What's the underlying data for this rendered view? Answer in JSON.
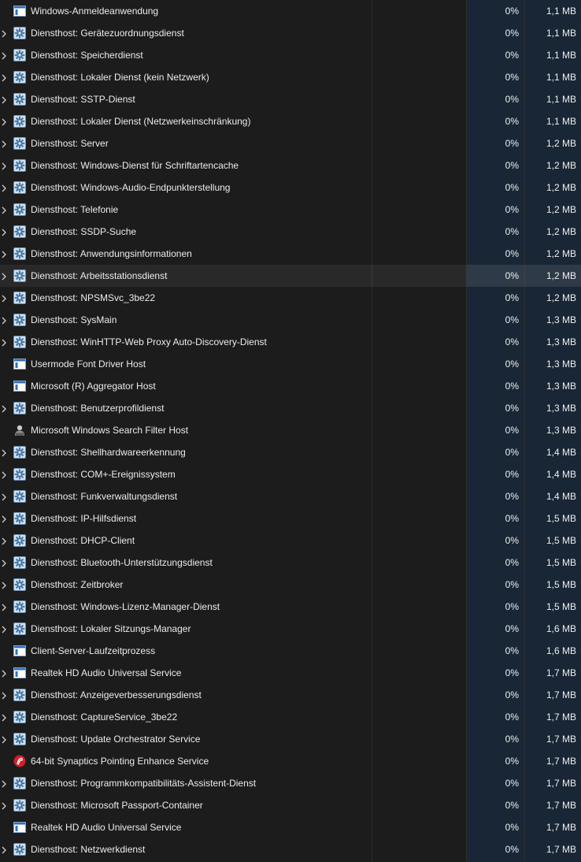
{
  "processes": [
    {
      "name": "Windows-Anmeldeanwendung",
      "icon": "window-icon",
      "expandable": false,
      "cpu": "0%",
      "memory": "1,1 MB"
    },
    {
      "name": "Diensthost: Gerätezuordnungsdienst",
      "icon": "gear-icon",
      "expandable": true,
      "cpu": "0%",
      "memory": "1,1 MB"
    },
    {
      "name": "Diensthost: Speicherdienst",
      "icon": "gear-icon",
      "expandable": true,
      "cpu": "0%",
      "memory": "1,1 MB"
    },
    {
      "name": "Diensthost: Lokaler Dienst (kein Netzwerk)",
      "icon": "gear-icon",
      "expandable": true,
      "cpu": "0%",
      "memory": "1,1 MB"
    },
    {
      "name": "Diensthost: SSTP-Dienst",
      "icon": "gear-icon",
      "expandable": true,
      "cpu": "0%",
      "memory": "1,1 MB"
    },
    {
      "name": "Diensthost: Lokaler Dienst (Netzwerkeinschränkung)",
      "icon": "gear-icon",
      "expandable": true,
      "cpu": "0%",
      "memory": "1,1 MB"
    },
    {
      "name": "Diensthost: Server",
      "icon": "gear-icon",
      "expandable": true,
      "cpu": "0%",
      "memory": "1,2 MB"
    },
    {
      "name": "Diensthost: Windows-Dienst für Schriftartencache",
      "icon": "gear-icon",
      "expandable": true,
      "cpu": "0%",
      "memory": "1,2 MB"
    },
    {
      "name": "Diensthost: Windows-Audio-Endpunkterstellung",
      "icon": "gear-icon",
      "expandable": true,
      "cpu": "0%",
      "memory": "1,2 MB"
    },
    {
      "name": "Diensthost: Telefonie",
      "icon": "gear-icon",
      "expandable": true,
      "cpu": "0%",
      "memory": "1,2 MB"
    },
    {
      "name": "Diensthost: SSDP-Suche",
      "icon": "gear-icon",
      "expandable": true,
      "cpu": "0%",
      "memory": "1,2 MB"
    },
    {
      "name": "Diensthost: Anwendungsinformationen",
      "icon": "gear-icon",
      "expandable": true,
      "cpu": "0%",
      "memory": "1,2 MB"
    },
    {
      "name": "Diensthost: Arbeitsstationsdienst",
      "icon": "gear-icon",
      "expandable": true,
      "cpu": "0%",
      "memory": "1,2 MB",
      "selected": true
    },
    {
      "name": "Diensthost: NPSMSvc_3be22",
      "icon": "gear-icon",
      "expandable": true,
      "cpu": "0%",
      "memory": "1,2 MB"
    },
    {
      "name": "Diensthost: SysMain",
      "icon": "gear-icon",
      "expandable": true,
      "cpu": "0%",
      "memory": "1,3 MB"
    },
    {
      "name": "Diensthost: WinHTTP-Web Proxy Auto-Discovery-Dienst",
      "icon": "gear-icon",
      "expandable": true,
      "cpu": "0%",
      "memory": "1,3 MB"
    },
    {
      "name": "Usermode Font Driver Host",
      "icon": "window-icon",
      "expandable": false,
      "cpu": "0%",
      "memory": "1,3 MB"
    },
    {
      "name": "Microsoft (R) Aggregator Host",
      "icon": "window-icon",
      "expandable": false,
      "cpu": "0%",
      "memory": "1,3 MB"
    },
    {
      "name": "Diensthost: Benutzerprofildienst",
      "icon": "gear-icon",
      "expandable": true,
      "cpu": "0%",
      "memory": "1,3 MB"
    },
    {
      "name": "Microsoft Windows Search Filter Host",
      "icon": "search-filter-icon",
      "expandable": false,
      "cpu": "0%",
      "memory": "1,3 MB"
    },
    {
      "name": "Diensthost: Shellhardwareerkennung",
      "icon": "gear-icon",
      "expandable": true,
      "cpu": "0%",
      "memory": "1,4 MB"
    },
    {
      "name": "Diensthost: COM+-Ereignissystem",
      "icon": "gear-icon",
      "expandable": true,
      "cpu": "0%",
      "memory": "1,4 MB"
    },
    {
      "name": "Diensthost: Funkverwaltungsdienst",
      "icon": "gear-icon",
      "expandable": true,
      "cpu": "0%",
      "memory": "1,4 MB"
    },
    {
      "name": "Diensthost: IP-Hilfsdienst",
      "icon": "gear-icon",
      "expandable": true,
      "cpu": "0%",
      "memory": "1,5 MB"
    },
    {
      "name": "Diensthost: DHCP-Client",
      "icon": "gear-icon",
      "expandable": true,
      "cpu": "0%",
      "memory": "1,5 MB"
    },
    {
      "name": "Diensthost: Bluetooth-Unterstützungsdienst",
      "icon": "gear-icon",
      "expandable": true,
      "cpu": "0%",
      "memory": "1,5 MB"
    },
    {
      "name": "Diensthost: Zeitbroker",
      "icon": "gear-icon",
      "expandable": true,
      "cpu": "0%",
      "memory": "1,5 MB"
    },
    {
      "name": "Diensthost: Windows-Lizenz-Manager-Dienst",
      "icon": "gear-icon",
      "expandable": true,
      "cpu": "0%",
      "memory": "1,5 MB"
    },
    {
      "name": "Diensthost: Lokaler Sitzungs-Manager",
      "icon": "gear-icon",
      "expandable": true,
      "cpu": "0%",
      "memory": "1,6 MB"
    },
    {
      "name": "Client-Server-Laufzeitprozess",
      "icon": "window-icon",
      "expandable": false,
      "cpu": "0%",
      "memory": "1,6 MB"
    },
    {
      "name": "Realtek HD Audio Universal Service",
      "icon": "window-icon",
      "expandable": true,
      "cpu": "0%",
      "memory": "1,7 MB"
    },
    {
      "name": "Diensthost: Anzeigeverbesserungsdienst",
      "icon": "gear-icon",
      "expandable": true,
      "cpu": "0%",
      "memory": "1,7 MB"
    },
    {
      "name": "Diensthost: CaptureService_3be22",
      "icon": "gear-icon",
      "expandable": true,
      "cpu": "0%",
      "memory": "1,7 MB"
    },
    {
      "name": "Diensthost: Update Orchestrator Service",
      "icon": "gear-icon",
      "expandable": true,
      "cpu": "0%",
      "memory": "1,7 MB"
    },
    {
      "name": "64-bit Synaptics Pointing Enhance Service",
      "icon": "synaptics-icon",
      "expandable": false,
      "cpu": "0%",
      "memory": "1,7 MB"
    },
    {
      "name": "Diensthost: Programmkompatibilitäts-Assistent-Dienst",
      "icon": "gear-icon",
      "expandable": true,
      "cpu": "0%",
      "memory": "1,7 MB"
    },
    {
      "name": "Diensthost: Microsoft Passport-Container",
      "icon": "gear-icon",
      "expandable": true,
      "cpu": "0%",
      "memory": "1,7 MB"
    },
    {
      "name": "Realtek HD Audio Universal Service",
      "icon": "window-icon",
      "expandable": false,
      "cpu": "0%",
      "memory": "1,7 MB"
    },
    {
      "name": "Diensthost: Netzwerkdienst",
      "icon": "gear-icon",
      "expandable": true,
      "cpu": "0%",
      "memory": "1,7 MB"
    }
  ]
}
